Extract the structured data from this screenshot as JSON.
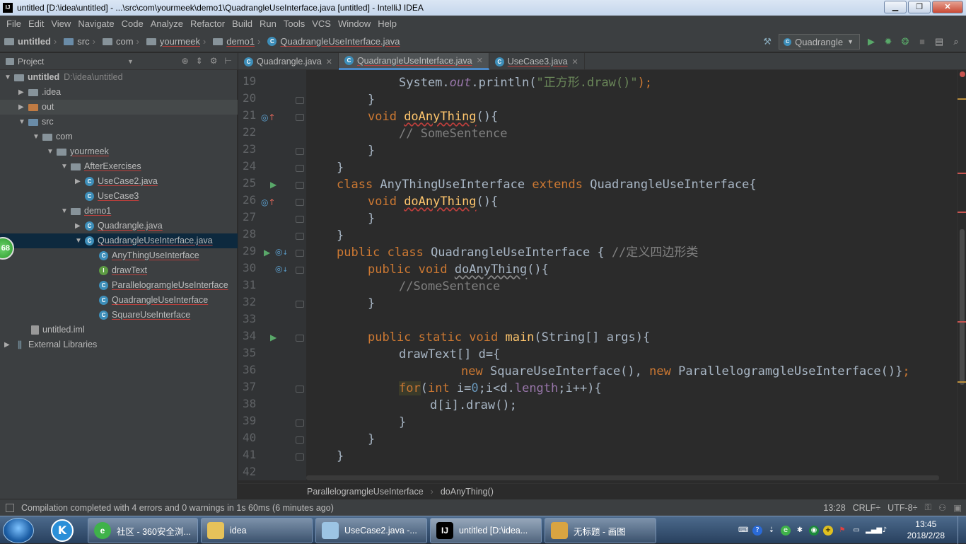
{
  "window": {
    "title": "untitled [D:\\idea\\untitled] - ...\\src\\com\\yourmeek\\demo1\\QuadrangleUseInterface.java [untitled] - IntelliJ IDEA",
    "minimize": "▁",
    "maximize": "❐",
    "close": "✕"
  },
  "menu": [
    "File",
    "Edit",
    "View",
    "Navigate",
    "Code",
    "Analyze",
    "Refactor",
    "Build",
    "Run",
    "Tools",
    "VCS",
    "Window",
    "Help"
  ],
  "navbar": {
    "crumbs": [
      "untitled",
      "src",
      "com",
      "yourmeek",
      "demo1",
      "QuadrangleUseInterface.java"
    ],
    "run_config": "Quadrangle"
  },
  "project_panel": {
    "title": "Project",
    "tree": [
      {
        "label": "untitled",
        "extra": "D:\\idea\\untitled"
      },
      {
        "label": ".idea"
      },
      {
        "label": "out"
      },
      {
        "label": "src"
      },
      {
        "label": "com"
      },
      {
        "label": "yourmeek"
      },
      {
        "label": "AfterExercises"
      },
      {
        "label": "UseCase2.java"
      },
      {
        "label": "UseCase3"
      },
      {
        "label": "demo1"
      },
      {
        "label": "Quadrangle.java"
      },
      {
        "label": "QuadrangleUseInterface.java"
      },
      {
        "label": "AnyThingUseInterface"
      },
      {
        "label": "drawText"
      },
      {
        "label": "ParallelogramgleUseInterface"
      },
      {
        "label": "QuadrangleUseInterface"
      },
      {
        "label": "SquareUseInterface"
      },
      {
        "label": "untitled.iml"
      },
      {
        "label": "External Libraries"
      }
    ],
    "badge": "68"
  },
  "tabs": [
    {
      "label": "Quadrangle.java"
    },
    {
      "label": "QuadrangleUseInterface.java"
    },
    {
      "label": "UseCase3.java"
    }
  ],
  "code": {
    "line_numbers": [
      "19",
      "20",
      "21",
      "22",
      "23",
      "24",
      "25",
      "26",
      "27",
      "28",
      "29",
      "30",
      "31",
      "32",
      "33",
      "34",
      "35",
      "36",
      "37",
      "38",
      "39",
      "40",
      "41",
      "42"
    ],
    "l19": {
      "a": "System.",
      "b": "out",
      "c": ".println(",
      "d": "\"正方形.draw()\"",
      "e": ");"
    },
    "l21": {
      "kw": "void ",
      "fn": "doAnyThing",
      "rest": "(){"
    },
    "l22": "// SomeSentence",
    "l25": {
      "kw1": "class ",
      "name": "AnyThingUseInterface ",
      "kw2": "extends ",
      "base": "QuadrangleUseInterface{"
    },
    "l29": {
      "kw": "public class ",
      "name": "QuadrangleUseInterface { ",
      "cm": "//定义四边形类"
    },
    "l30": {
      "kw": "public void ",
      "fn": "doAnyThing",
      "rest": "(){"
    },
    "l31": "//SomeSentence",
    "l34": {
      "kw": "public static void ",
      "fn": "main",
      "rest": "(String[] args){"
    },
    "l35": "drawText[] d={",
    "l36": {
      "kw1": "new ",
      "a": "SquareUseInterface(), ",
      "kw2": "new ",
      "b": "ParallelogramgleUseInterface()}",
      "semi": ";"
    },
    "l37": {
      "kw1": "for",
      "a": "(",
      "kw2": "int ",
      "b": "i=",
      "n": "0",
      "c": ";i<d.",
      "p": "length",
      "d": ";i++){"
    },
    "l38": "d[i].draw();"
  },
  "breadcrumb": [
    "ParallelogramgleUseInterface",
    "doAnyThing()"
  ],
  "status": {
    "message": "Compilation completed with 4 errors and 0 warnings in 1s 60ms (6 minutes ago)",
    "position": "13:28",
    "line_sep": "CRLF÷",
    "encoding": "UTF-8÷"
  },
  "taskbar": {
    "items": [
      {
        "label": "社区 - 360安全浏..."
      },
      {
        "label": "idea"
      },
      {
        "label": "UseCase2.java -..."
      },
      {
        "label": "untitled [D:\\idea..."
      },
      {
        "label": "无标题 - 画图"
      }
    ],
    "time": "13:45",
    "date": "2018/2/28"
  }
}
